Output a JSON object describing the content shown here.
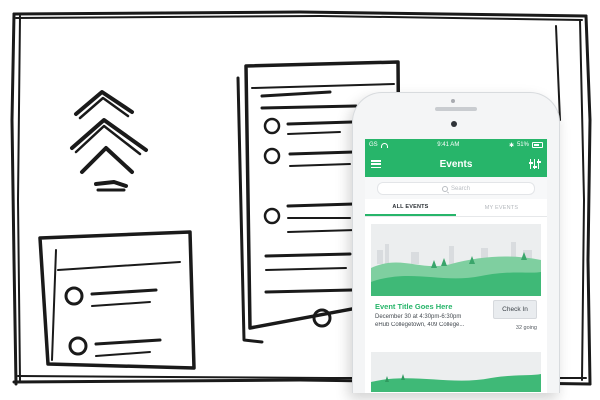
{
  "status_bar": {
    "carrier": "GS",
    "time": "9:41 AM",
    "battery": "51",
    "battery_unit": "%"
  },
  "nav": {
    "title": "Events"
  },
  "search": {
    "placeholder": "Search"
  },
  "tabs": [
    {
      "label": "ALL EVENTS",
      "active": true
    },
    {
      "label": "MY EVENTS",
      "active": false
    }
  ],
  "event": {
    "title": "Event Title Goes Here",
    "date": "December 30 at 4:30pm-6:30pm",
    "location": "eHub Collegetown, 409 College...",
    "button_label": "Check In",
    "going": "32 going"
  },
  "colors": {
    "brand_green": "#27b56a",
    "sketch_ink": "#1a1a1a"
  }
}
